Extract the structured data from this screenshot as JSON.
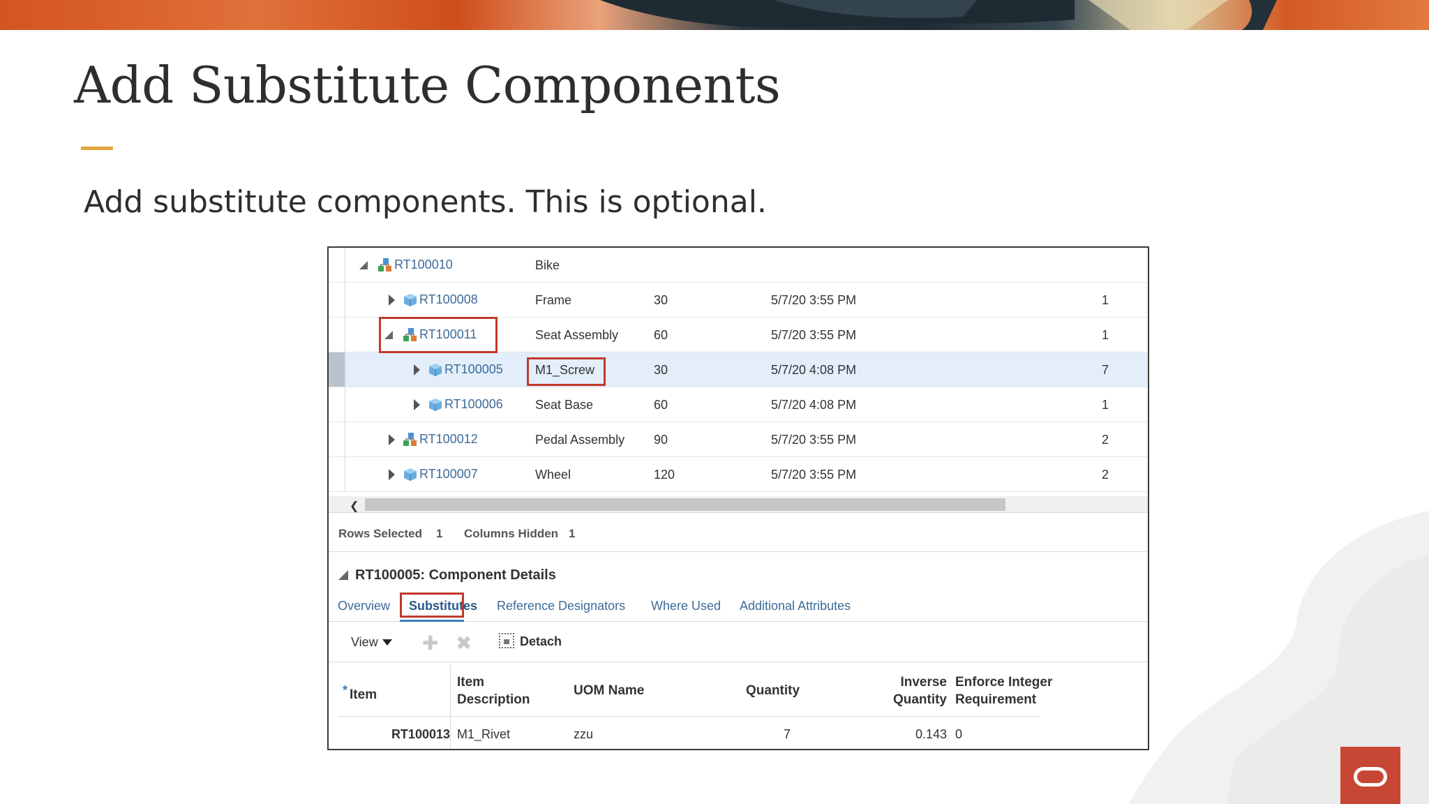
{
  "slide": {
    "title": "Add Substitute Components",
    "subtitle": "Add substitute components. This is optional.",
    "accent_color": "#e0a640",
    "logo_color": "#c74634"
  },
  "tree": {
    "rows": [
      {
        "item": "RT100010",
        "description": "Bike",
        "quantity": "",
        "date": "",
        "count": "",
        "icon": "assembly-icon",
        "expanded": true
      },
      {
        "item": "RT100008",
        "description": "Frame",
        "quantity": "30",
        "date": "5/7/20 3:55 PM",
        "count": "1",
        "icon": "component-cube-icon",
        "expanded": false
      },
      {
        "item": "RT100011",
        "description": "Seat Assembly",
        "quantity": "60",
        "date": "5/7/20 3:55 PM",
        "count": "1",
        "icon": "assembly-icon",
        "expanded": true
      },
      {
        "item": "RT100005",
        "description": "M1_Screw",
        "quantity": "30",
        "date": "5/7/20 4:08 PM",
        "count": "7",
        "icon": "component-cube-icon",
        "expanded": false,
        "selected": true
      },
      {
        "item": "RT100006",
        "description": "Seat Base",
        "quantity": "60",
        "date": "5/7/20 4:08 PM",
        "count": "1",
        "icon": "component-cube-icon",
        "expanded": false
      },
      {
        "item": "RT100012",
        "description": "Pedal Assembly",
        "quantity": "90",
        "date": "5/7/20 3:55 PM",
        "count": "2",
        "icon": "assembly-icon",
        "expanded": false
      },
      {
        "item": "RT100007",
        "description": "Wheel",
        "quantity": "120",
        "date": "5/7/20 3:55 PM",
        "count": "2",
        "icon": "component-cube-icon",
        "expanded": false
      }
    ]
  },
  "status": {
    "rows_selected_label": "Rows Selected",
    "rows_selected_value": "1",
    "columns_hidden_label": "Columns Hidden",
    "columns_hidden_value": "1"
  },
  "details": {
    "header": "RT100005: Component Details",
    "tabs": [
      {
        "label": "Overview"
      },
      {
        "label": "Substitutes",
        "active": true
      },
      {
        "label": "Reference Designators"
      },
      {
        "label": "Where Used"
      },
      {
        "label": "Additional Attributes"
      }
    ],
    "toolbar": {
      "view_label": "View",
      "add_icon": "plus-icon",
      "delete_icon": "x-icon",
      "detach_label": "Detach"
    },
    "grid": {
      "required_marker": "*",
      "columns": {
        "item": "Item",
        "item_description_line1": "Item",
        "item_description_line2": "Description",
        "uom_name": "UOM Name",
        "quantity": "Quantity",
        "inverse_quantity_line1": "Inverse",
        "inverse_quantity_line2": "Quantity",
        "enforce_line1": "Enforce Integer",
        "enforce_line2": "Requirement"
      },
      "rows": [
        {
          "item": "RT100013",
          "item_description": "M1_Rivet",
          "uom_name": "zzu",
          "quantity": "7",
          "inverse_quantity": "0.143",
          "enforce_integer_requirement": "0"
        }
      ]
    }
  }
}
